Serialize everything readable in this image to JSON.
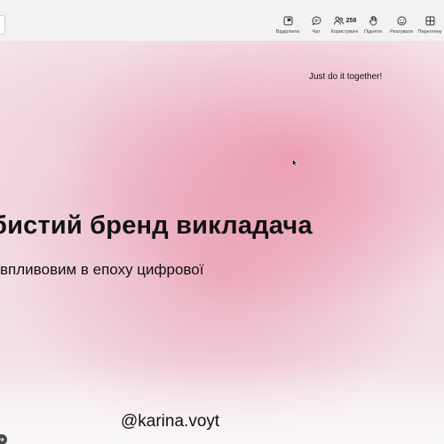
{
  "toolbar": {
    "items": [
      {
        "label": "Відкріпити",
        "icon": "unpin-icon"
      },
      {
        "label": "Чат",
        "icon": "chat-icon"
      },
      {
        "label": "Користувачі",
        "icon": "people-icon",
        "count": "258"
      },
      {
        "label": "Підняти",
        "icon": "raise-hand-icon"
      },
      {
        "label": "Реагувати",
        "icon": "react-icon"
      },
      {
        "label": "Перегляну",
        "icon": "view-icon"
      }
    ]
  },
  "slide": {
    "tagline": "Just do it together!",
    "title": "бистий бренд викладача",
    "subtitle": "впливовим в епоху цифрової",
    "handle": "@karina.voyt"
  }
}
